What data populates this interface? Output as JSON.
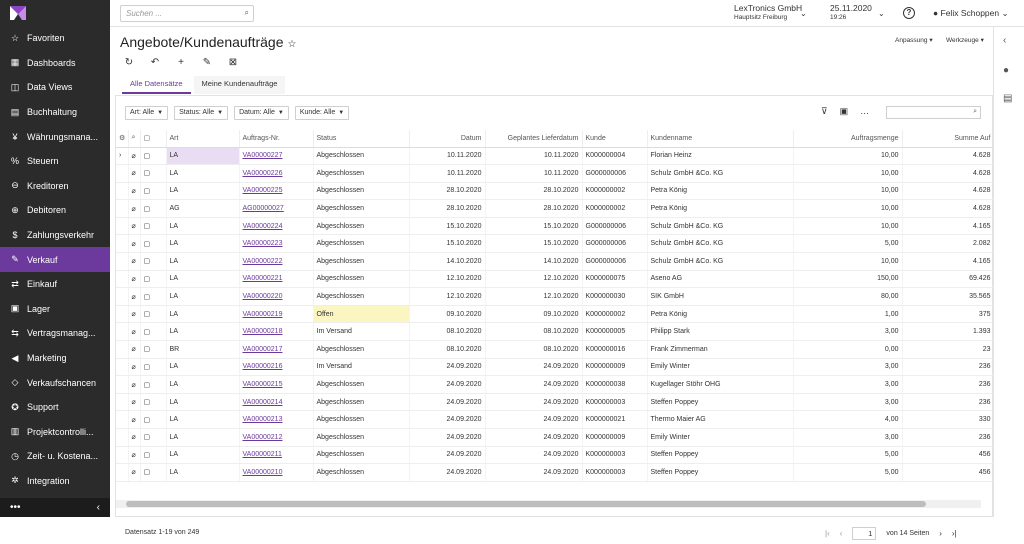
{
  "sidebar": {
    "items": [
      {
        "icon": "☆",
        "label": "Favoriten"
      },
      {
        "icon": "▦",
        "label": "Dashboards"
      },
      {
        "icon": "◫",
        "label": "Data Views"
      },
      {
        "icon": "▤",
        "label": "Buchhaltung"
      },
      {
        "icon": "¥",
        "label": "Währungsmana..."
      },
      {
        "icon": "%",
        "label": "Steuern"
      },
      {
        "icon": "⊖",
        "label": "Kreditoren"
      },
      {
        "icon": "⊕",
        "label": "Debitoren"
      },
      {
        "icon": "$",
        "label": "Zahlungsverkehr"
      },
      {
        "icon": "✎",
        "label": "Verkauf"
      },
      {
        "icon": "⇄",
        "label": "Einkauf"
      },
      {
        "icon": "▣",
        "label": "Lager"
      },
      {
        "icon": "⇆",
        "label": "Vertragsmanag..."
      },
      {
        "icon": "◀",
        "label": "Marketing"
      },
      {
        "icon": "◇",
        "label": "Verkaufschancen"
      },
      {
        "icon": "✪",
        "label": "Support"
      },
      {
        "icon": "▥",
        "label": "Projektcontrolli..."
      },
      {
        "icon": "◷",
        "label": "Zeit- u. Kostena..."
      },
      {
        "icon": "✲",
        "label": "Integration"
      }
    ],
    "active_index": 9,
    "footer_more": "•••",
    "footer_collapse": "‹"
  },
  "topbar": {
    "search_placeholder": "Suchen ...",
    "company": "LexTronics GmbH",
    "branch": "Hauptsitz Freiburg",
    "date": "25.11.2020",
    "time": "19:26",
    "help": "?",
    "user": "Felix Schoppen"
  },
  "page": {
    "title": "Angebote/Kundenaufträge",
    "anpassung": "Anpassung",
    "werkzeuge": "Werkzeuge",
    "tabs": [
      "Alle Datensätze",
      "Meine Kundenaufträge"
    ],
    "filters": [
      "Art: Alle",
      "Status: Alle",
      "Datum: Alle",
      "Kunde: Alle"
    ]
  },
  "table": {
    "columns": [
      "Art",
      "Auftrags-Nr.",
      "Status",
      "Datum",
      "Geplantes Lieferdatum",
      "Kunde",
      "Kundenname",
      "Auftragsmenge",
      "Summe Auf"
    ],
    "rows": [
      [
        "LA",
        "VA00000227",
        "Abgeschlossen",
        "10.11.2020",
        "10.11.2020",
        "K000000004",
        "Florian Heinz",
        "10,00",
        "4.628"
      ],
      [
        "LA",
        "VA00000226",
        "Abgeschlossen",
        "10.11.2020",
        "10.11.2020",
        "G000000006",
        "Schulz GmbH &Co. KG",
        "10,00",
        "4.628"
      ],
      [
        "LA",
        "VA00000225",
        "Abgeschlossen",
        "28.10.2020",
        "28.10.2020",
        "K000000002",
        "Petra König",
        "10,00",
        "4.628"
      ],
      [
        "AG",
        "AG00000027",
        "Abgeschlossen",
        "28.10.2020",
        "28.10.2020",
        "K000000002",
        "Petra König",
        "10,00",
        "4.628"
      ],
      [
        "LA",
        "VA00000224",
        "Abgeschlossen",
        "15.10.2020",
        "15.10.2020",
        "G000000006",
        "Schulz GmbH &Co. KG",
        "10,00",
        "4.165"
      ],
      [
        "LA",
        "VA00000223",
        "Abgeschlossen",
        "15.10.2020",
        "15.10.2020",
        "G000000006",
        "Schulz GmbH &Co. KG",
        "5,00",
        "2.082"
      ],
      [
        "LA",
        "VA00000222",
        "Abgeschlossen",
        "14.10.2020",
        "14.10.2020",
        "G000000006",
        "Schulz GmbH &Co. KG",
        "10,00",
        "4.165"
      ],
      [
        "LA",
        "VA00000221",
        "Abgeschlossen",
        "12.10.2020",
        "12.10.2020",
        "K000000075",
        "Aseno AG",
        "150,00",
        "69.426"
      ],
      [
        "LA",
        "VA00000220",
        "Abgeschlossen",
        "12.10.2020",
        "12.10.2020",
        "K000000030",
        "SIK GmbH",
        "80,00",
        "35.565"
      ],
      [
        "LA",
        "VA00000219",
        "Offen",
        "09.10.2020",
        "09.10.2020",
        "K000000002",
        "Petra König",
        "1,00",
        "375"
      ],
      [
        "LA",
        "VA00000218",
        "Im Versand",
        "08.10.2020",
        "08.10.2020",
        "K000000005",
        "Philipp Stark",
        "3,00",
        "1.393"
      ],
      [
        "BR",
        "VA00000217",
        "Abgeschlossen",
        "08.10.2020",
        "08.10.2020",
        "K000000016",
        "Frank Zimmerman",
        "0,00",
        "23"
      ],
      [
        "LA",
        "VA00000216",
        "Im Versand",
        "24.09.2020",
        "24.09.2020",
        "K000000009",
        "Emily Winter",
        "3,00",
        "236"
      ],
      [
        "LA",
        "VA00000215",
        "Abgeschlossen",
        "24.09.2020",
        "24.09.2020",
        "K000000038",
        "Kugellager Stöhr OHG",
        "3,00",
        "236"
      ],
      [
        "LA",
        "VA00000214",
        "Abgeschlossen",
        "24.09.2020",
        "24.09.2020",
        "K000000003",
        "Steffen Poppey",
        "3,00",
        "236"
      ],
      [
        "LA",
        "VA00000213",
        "Abgeschlossen",
        "24.09.2020",
        "24.09.2020",
        "K000000021",
        "Thermo Maier AG",
        "4,00",
        "330"
      ],
      [
        "LA",
        "VA00000212",
        "Abgeschlossen",
        "24.09.2020",
        "24.09.2020",
        "K000000009",
        "Emily Winter",
        "3,00",
        "236"
      ],
      [
        "LA",
        "VA00000211",
        "Abgeschlossen",
        "24.09.2020",
        "24.09.2020",
        "K000000003",
        "Steffen Poppey",
        "5,00",
        "456"
      ],
      [
        "LA",
        "VA00000210",
        "Abgeschlossen",
        "24.09.2020",
        "24.09.2020",
        "K000000003",
        "Steffen Poppey",
        "5,00",
        "456"
      ]
    ],
    "selected_row": 0
  },
  "footer": {
    "record_info": "Datensatz 1-19 von 249",
    "page": "1",
    "of_pages": "von 14 Seiten"
  }
}
